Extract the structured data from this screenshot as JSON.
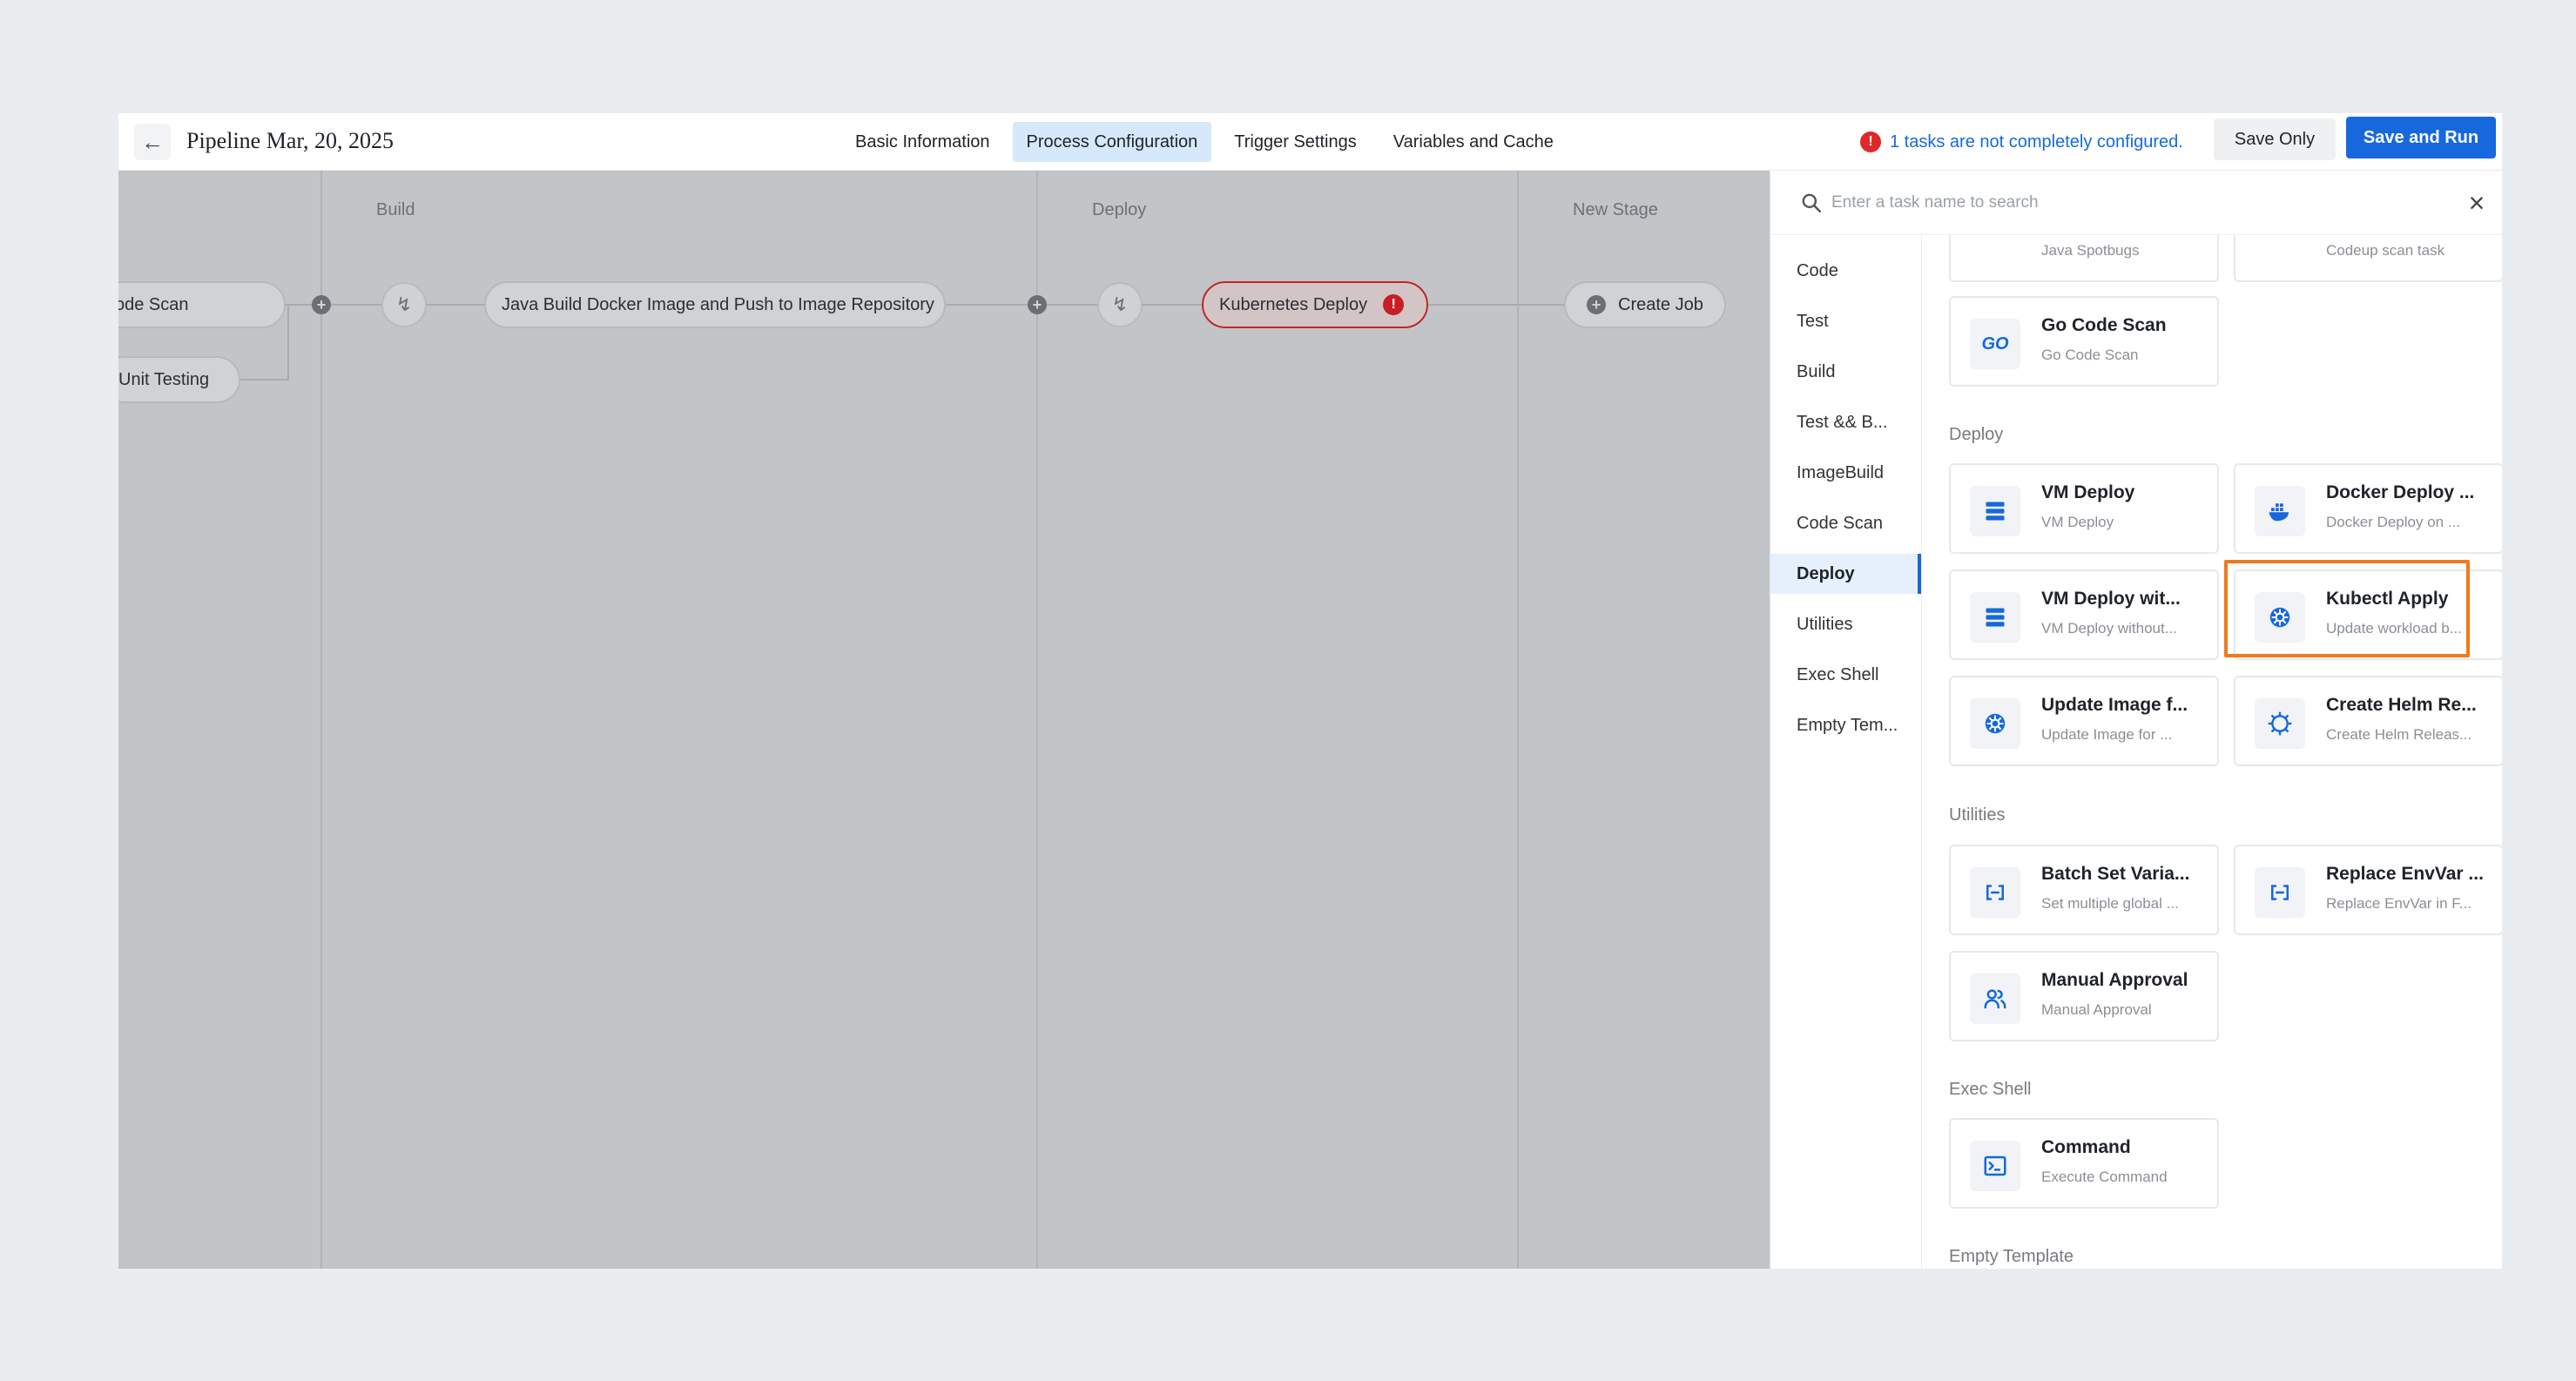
{
  "header": {
    "title": "Pipeline Mar, 20, 2025",
    "back_icon": "arrow-left-icon",
    "tabs": [
      {
        "label": "Basic Information",
        "active": false
      },
      {
        "label": "Process Configuration",
        "active": true
      },
      {
        "label": "Trigger Settings",
        "active": false
      },
      {
        "label": "Variables and Cache",
        "active": false
      }
    ],
    "warning": "1 tasks are not completely configured.",
    "save_only": "Save Only",
    "save_and_run": "Save and Run"
  },
  "canvas": {
    "stages": [
      "Build",
      "Deploy",
      "New Stage"
    ],
    "nodes": {
      "code_scan": "ode Scan",
      "unit_testing": "Unit Testing",
      "java_build": "Java Build Docker Image and Push to Image Repository",
      "kubernetes_deploy": "Kubernetes Deploy",
      "create_job": "Create Job"
    }
  },
  "panel": {
    "search_placeholder": "Enter a task name to search",
    "categories": [
      {
        "label": "Code",
        "active": false
      },
      {
        "label": "Test",
        "active": false
      },
      {
        "label": "Build",
        "active": false
      },
      {
        "label": "Test && B...",
        "active": false
      },
      {
        "label": "ImageBuild",
        "active": false
      },
      {
        "label": "Code Scan",
        "active": false
      },
      {
        "label": "Deploy",
        "active": true
      },
      {
        "label": "Utilities",
        "active": false
      },
      {
        "label": "Exec Shell",
        "active": false
      },
      {
        "label": "Empty Tem...",
        "active": false
      }
    ],
    "partial": {
      "left_desc": "Java Spotbugs",
      "right_desc": "Codeup scan task"
    },
    "go_scan": {
      "name": "Go Code Scan",
      "desc": "Go Code Scan",
      "icon": "go-icon"
    },
    "sections": {
      "deploy": "Deploy",
      "utilities": "Utilities",
      "exec_shell": "Exec Shell",
      "empty_template": "Empty Template"
    },
    "deploy_cards": [
      {
        "name": "VM Deploy",
        "desc": "VM Deploy",
        "icon": "server-icon"
      },
      {
        "name": "Docker Deploy ...",
        "desc": "Docker Deploy on ...",
        "icon": "docker-icon"
      },
      {
        "name": "VM Deploy wit...",
        "desc": "VM Deploy without...",
        "icon": "server-icon"
      },
      {
        "name": "Kubectl Apply",
        "desc": "Update workload b...",
        "icon": "kubernetes-icon"
      },
      {
        "name": "Update Image f...",
        "desc": "Update Image for ...",
        "icon": "kubernetes-icon"
      },
      {
        "name": "Create Helm Re...",
        "desc": "Create Helm Releas...",
        "icon": "helm-icon"
      }
    ],
    "utility_cards": [
      {
        "name": "Batch Set Varia...",
        "desc": "Set multiple global ...",
        "icon": "variable-icon"
      },
      {
        "name": "Replace EnvVar ...",
        "desc": "Replace EnvVar in F...",
        "icon": "variable-icon"
      },
      {
        "name": "Manual Approval",
        "desc": "Manual Approval",
        "icon": "users-icon"
      }
    ],
    "shell_cards": [
      {
        "name": "Command",
        "desc": "Execute Command",
        "icon": "terminal-icon"
      }
    ]
  },
  "colors": {
    "primary": "#1668dc",
    "highlight": "#ef7a1f",
    "error": "#c81e24"
  }
}
